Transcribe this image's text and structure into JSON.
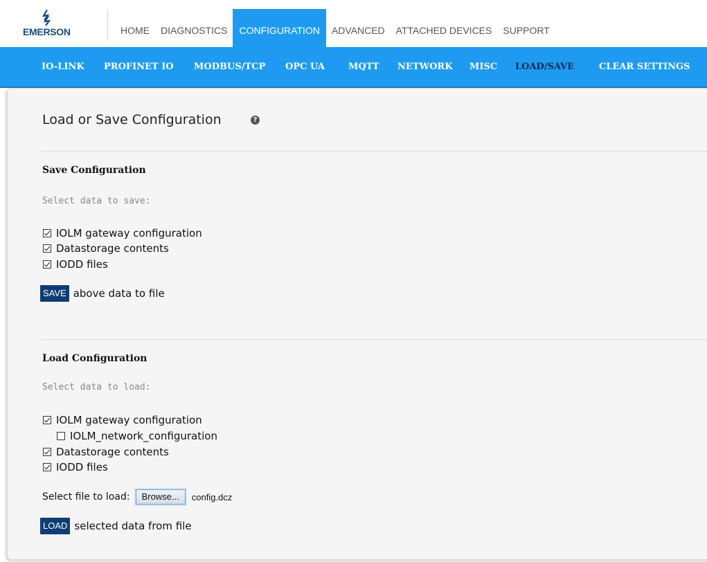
{
  "brand": {
    "name": "EMERSON"
  },
  "top_nav": [
    {
      "label": "HOME",
      "active": false
    },
    {
      "label": "DIAGNOSTICS",
      "active": false
    },
    {
      "label": "CONFIGURATION",
      "active": true
    },
    {
      "label": "ADVANCED",
      "active": false
    },
    {
      "label": "ATTACHED DEVICES",
      "active": false
    },
    {
      "label": "SUPPORT",
      "active": false
    }
  ],
  "sub_nav": [
    {
      "label": "IO-LINK",
      "active": false
    },
    {
      "label": "PROFINET IO",
      "active": false
    },
    {
      "label": "MODBUS/TCP",
      "active": false
    },
    {
      "label": "OPC UA",
      "active": false
    },
    {
      "label": "MQTT",
      "active": false
    },
    {
      "label": "NETWORK",
      "active": false
    },
    {
      "label": "MISC",
      "active": false
    },
    {
      "label": "LOAD/SAVE",
      "active": true
    },
    {
      "label": "CLEAR SETTINGS",
      "active": false
    }
  ],
  "page": {
    "title": "Load or Save Configuration",
    "help_icon": "question-circle-icon"
  },
  "save_section": {
    "title": "Save Configuration",
    "hint": "Select data to save:",
    "options": [
      {
        "label": "IOLM gateway configuration",
        "checked": true
      },
      {
        "label": "Datastorage contents",
        "checked": true
      },
      {
        "label": "IODD files",
        "checked": true
      }
    ],
    "button_label": "SAVE",
    "button_suffix": "above data to file"
  },
  "load_section": {
    "title": "Load Configuration",
    "hint": "Select data to load:",
    "options": [
      {
        "label": "IOLM gateway configuration",
        "checked": true
      },
      {
        "label": "IOLM_network_configuration",
        "checked": false
      },
      {
        "label": "Datastorage contents",
        "checked": true
      },
      {
        "label": "IODD files",
        "checked": true
      }
    ],
    "file_label": "Select file to load:",
    "browse_label": "Browse...",
    "file_name": "config.dcz",
    "button_label": "LOAD",
    "button_suffix": "selected data from file"
  },
  "colors": {
    "accent_blue": "#1e9bf0",
    "button_navy": "#0e3d73",
    "brand_navy": "#1b4a7e"
  }
}
